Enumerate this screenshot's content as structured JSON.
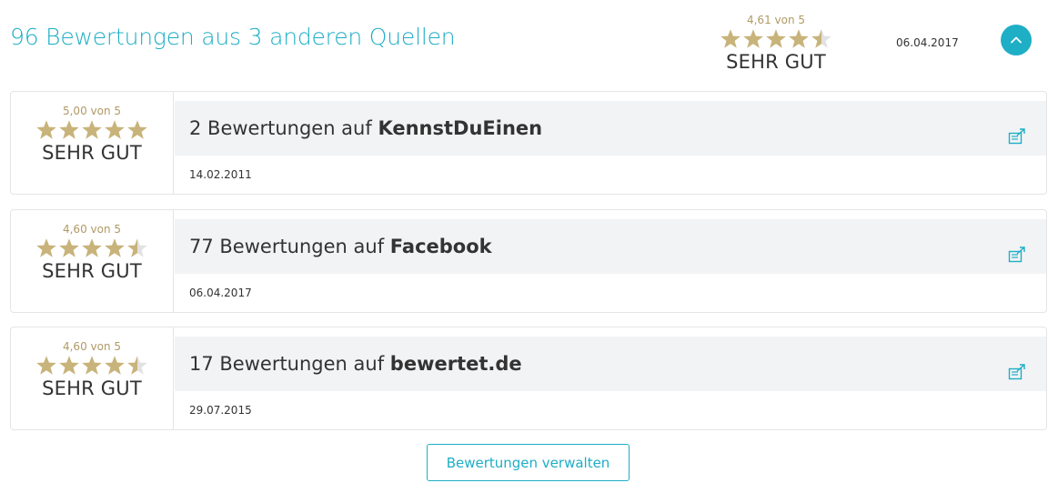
{
  "header": {
    "title": "96 Bewertungen aus 3 anderen Quellen",
    "rating_text": "4,61 von 5",
    "stars": 4.61,
    "label": "SEHR GUT",
    "date": "06.04.2017",
    "collapse_icon": "chevron-up-icon"
  },
  "sources": [
    {
      "rating_text": "5,00 von 5",
      "stars": 5.0,
      "label": "SEHR GUT",
      "title_prefix": "2 Bewertungen auf ",
      "source_name": "KennstDuEinen",
      "date": "14.02.2011",
      "link_icon": "external-link-icon"
    },
    {
      "rating_text": "4,60 von 5",
      "stars": 4.6,
      "label": "SEHR GUT",
      "title_prefix": "77 Bewertungen auf ",
      "source_name": "Facebook",
      "date": "06.04.2017",
      "link_icon": "external-link-icon"
    },
    {
      "rating_text": "4,60 von 5",
      "stars": 4.6,
      "label": "SEHR GUT",
      "title_prefix": "17 Bewertungen auf ",
      "source_name": "bewertet.de",
      "date": "29.07.2015",
      "link_icon": "external-link-icon"
    }
  ],
  "manage_button": {
    "label": "Bewertungen verwalten"
  },
  "colors": {
    "accent": "#1eaec6",
    "star_gold": "#c8b37a",
    "star_empty": "#e2e2e2"
  }
}
